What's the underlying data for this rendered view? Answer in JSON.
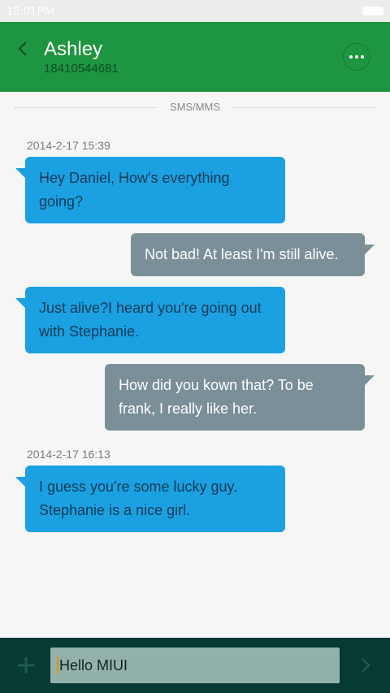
{
  "status_bar": {
    "time": "12:01PM"
  },
  "header": {
    "contact_name": "Ashley",
    "contact_number": "18410544681"
  },
  "thread": {
    "channel_label": "SMS/MMS",
    "timestamps": [
      "2014-2-17 15:39",
      "2014-2-17 16:13"
    ],
    "messages": [
      {
        "direction": "incoming",
        "text": "Hey Daniel, How's everything going?"
      },
      {
        "direction": "outgoing",
        "text": "Not bad! At least I'm still alive."
      },
      {
        "direction": "incoming",
        "text": "Just  alive?I heard you're going out with Stephanie."
      },
      {
        "direction": "outgoing",
        "text": "How did you kown that? To be frank, I really like her."
      },
      {
        "direction": "incoming",
        "text": "I guess you're some lucky guy. Stephanie is a nice girl."
      }
    ]
  },
  "composer": {
    "value": "Hello MIUI"
  },
  "colors": {
    "header": "#1e9540",
    "incoming_bubble": "#1ba0e2",
    "outgoing_bubble": "#7b8f98",
    "composer_bar": "#063a32"
  }
}
